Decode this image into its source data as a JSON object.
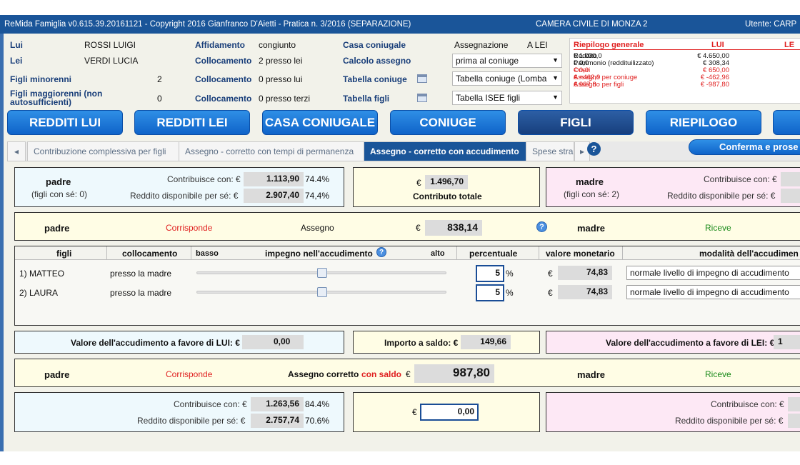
{
  "titlebar": {
    "app": "ReMida Famiglia v0.615.39.20161121 - Copyright 2016 Gianfranco D'Aietti - Pratica n. 3/2016 (SEPARAZIONE)",
    "court": "CAMERA CIVILE DI MONZA 2",
    "user": "Utente: CARP"
  },
  "header": {
    "lui_label": "Lui",
    "lui_name": "ROSSI LUIGI",
    "lei_label": "Lei",
    "lei_name": "VERDI LUCIA",
    "minori_label": "Figli minorenni",
    "minori_count": "2",
    "maggiori_label": "Figli maggiorenni (non autosufficienti)",
    "maggiori_count": "0",
    "affidamento_label": "Affidamento",
    "affidamento_value": "congiunto",
    "coll1_label": "Collocamento",
    "coll1_value": "2 presso lei",
    "coll2_label": "Collocamento",
    "coll2_value": "0 presso lui",
    "coll3_label": "Collocamento",
    "coll3_value": "0 presso terzi",
    "casa_label": "Casa coniugale",
    "calcolo_label": "Calcolo assegno",
    "tab_coniuge_label": "Tabella coniuge",
    "tab_figli_label": "Tabella figli",
    "assegnazione_label": "Assegnazione",
    "assegnazione_value": "A LEI",
    "calcolo_select": "prima al coniuge",
    "tab_coniuge_select": "Tabella coniuge (Lomba",
    "tab_figli_select": "Tabella ISEE figli"
  },
  "riepilogo": {
    "title": "Riepilogo generale",
    "col_lui": "LUI",
    "col_lei": "LE",
    "rows": [
      {
        "label": "Reddito",
        "lui": "€ 4.650,00",
        "lei": "€ 1.030,0",
        "color": "#111"
      },
      {
        "label": "Patrimonio (reddituilizzato)",
        "lui": "€ 308,34",
        "lei": "€ 0,0",
        "color": "#111"
      },
      {
        "label": "Oneri",
        "lui": "€ 650,00",
        "lei": "€ 0,0",
        "color": "#e02020"
      },
      {
        "label": "Assegno per coniuge",
        "lui": "€ -462,96",
        "lei": "€ +462,9",
        "color": "#e02020"
      },
      {
        "label": "Assegno per figli",
        "lui": "€ -987,80",
        "lei": "€ 987,8",
        "color": "#e02020"
      }
    ]
  },
  "nav": [
    "REDDITI LUI",
    "REDDITI LEI",
    "CASA CONIUGALE",
    "CONIUGE",
    "FIGLI",
    "RIEPILOGO"
  ],
  "tabs": [
    "Contribuzione complessiva per figli",
    "Assegno - corretto con tempi di permanenza",
    "Assegno - corretto con accudimento",
    "Spese stra"
  ],
  "confirm_button": "Conferma e prose",
  "top": {
    "padre": "padre",
    "padre_sub": "(figli con sé: 0)",
    "contribuisce_label": "Contribuisce con: €",
    "contribuisce_value": "1.113,90",
    "contribuisce_pct": "74.4%",
    "reddito_label": "Reddito disponibile per sé: €",
    "reddito_value": "2.907,40",
    "reddito_pct": "74,4%",
    "euro": "€",
    "totale_value": "1.496,70",
    "totale_label": "Contributo totale",
    "madre": "madre",
    "madre_sub": "(figli con sé: 2)",
    "m_contribuisce_label": "Contribuisce con: €",
    "m_reddito_label": "Reddito disponibile per sé: €"
  },
  "assegno": {
    "padre": "padre",
    "corrisponde": "Corrisponde",
    "label": "Assegno",
    "euro": "€",
    "value": "838,14",
    "madre": "madre",
    "riceve": "Riceve"
  },
  "figli_table": {
    "headers": {
      "figli": "figli",
      "collocamento": "collocamento",
      "basso": "basso",
      "impegno": "impegno nell'accudimento",
      "alto": "alto",
      "percentuale": "percentuale",
      "valore": "valore monetario",
      "modalita": "modalità dell'accudimen"
    },
    "rows": [
      {
        "name": "1) MATTEO",
        "coll": "presso la madre",
        "impegno": 0.5,
        "pct": "5",
        "pct_sign": "%",
        "euro": "€",
        "valore": "74,83",
        "modalita": "normale livello di impegno di accudimento"
      },
      {
        "name": "2) LAURA",
        "coll": "presso la madre",
        "impegno": 0.5,
        "pct": "5",
        "pct_sign": "%",
        "euro": "€",
        "valore": "74,83",
        "modalita": "normale livello di impegno di accudimento"
      }
    ]
  },
  "accudimento": {
    "lui_label": "Valore dell'accudimento a favore di LUI: €",
    "lui_value": "0,00",
    "saldo_label": "Importo a saldo: €",
    "saldo_value": "149,66",
    "lei_label": "Valore dell'accudimento a favore di LEI: €",
    "lei_value": "1"
  },
  "corretto": {
    "padre": "padre",
    "corrisponde": "Corrisponde",
    "label": "Assegno corretto",
    "con_saldo": "con saldo",
    "euro": "€",
    "value": "987,80",
    "madre": "madre",
    "riceve": "Riceve"
  },
  "bottom": {
    "contribuisce_label": "Contribuisce con: €",
    "contribuisce_value": "1.263,56",
    "contribuisce_pct": "84.4%",
    "reddito_label": "Reddito disponibile per sé: €",
    "reddito_value": "2.757,74",
    "reddito_pct": "70.6%",
    "euro": "€",
    "input_value": "0,00",
    "m_contribuisce_label": "Contribuisce con: €",
    "m_reddito_label": "Reddito disponibile per sé: €"
  }
}
